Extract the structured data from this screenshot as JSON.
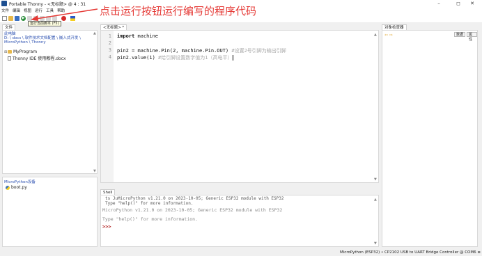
{
  "window": {
    "title": "Portable Thonny  -  <无标题>  @  4 : 31",
    "minimize": "–",
    "maximize": "◻",
    "close": "✕"
  },
  "menu": [
    "文件",
    "编辑",
    "视图",
    "运行",
    "工具",
    "帮助"
  ],
  "toolbar": {
    "icons": [
      "new-file-icon",
      "open-folder-icon",
      "save-icon",
      "run-icon",
      "debug-icon",
      "step-over-icon",
      "step-into-icon",
      "step-out-icon",
      "resume-icon",
      "stop-icon",
      "flag-icon"
    ],
    "tooltip": "运行当前脚本 (F5)"
  },
  "annotation": {
    "text": "点击运行按钮运行编写的程序代码",
    "color": "#e53935"
  },
  "files": {
    "tab": "文件",
    "location_label": "此电脑",
    "path": [
      "D: \\ docs \\ 软件技术文档配置 \\ 嵌入式开发 \\",
      "MicroPython \\ Thonny"
    ],
    "items": [
      {
        "name": "MyProgram",
        "type": "folder",
        "expander": "⊞"
      },
      {
        "name": "Thonny IDE 使用教程.docx",
        "type": "document"
      }
    ],
    "scroll_up": "▲",
    "scroll_down": "▼"
  },
  "micropython": {
    "header": "MicroPython设备",
    "items": [
      {
        "name": "boot.py"
      }
    ]
  },
  "editor": {
    "tab": "<无标题> *",
    "lines": [
      {
        "n": "1",
        "kw": "import",
        "code": " machine",
        "comment": ""
      },
      {
        "n": "2",
        "kw": "",
        "code": "",
        "comment": ""
      },
      {
        "n": "3",
        "kw": "",
        "code": "pin2 = machine.Pin(2, machine.Pin.OUT) ",
        "comment": "#设置2号引脚为输出引脚"
      },
      {
        "n": "4",
        "kw": "",
        "code": "pin2.value(1) ",
        "comment": "#给引脚设置数字值为1（高电平）"
      }
    ]
  },
  "shell": {
    "tab": "Shell",
    "old_lines": [
      "ts JuMicroPython v1.21.0 on 2023-10-05; Generic ESP32 module with ESP32",
      "Type \"help()\" for more information."
    ],
    "lines": [
      "MicroPython v1.21.0 on 2023-10-05; Generic ESP32 module with ESP32",
      "Type \"help()\" for more information."
    ],
    "prompt": ">>>"
  },
  "inspector": {
    "tab": "对象检查器",
    "nav": "⇦ ⇨",
    "buttons": [
      "数据",
      "属性"
    ]
  },
  "status": "MicroPython (ESP32)  •  CP2102 USB to UART Bridge Controller @ COM6  ≡"
}
